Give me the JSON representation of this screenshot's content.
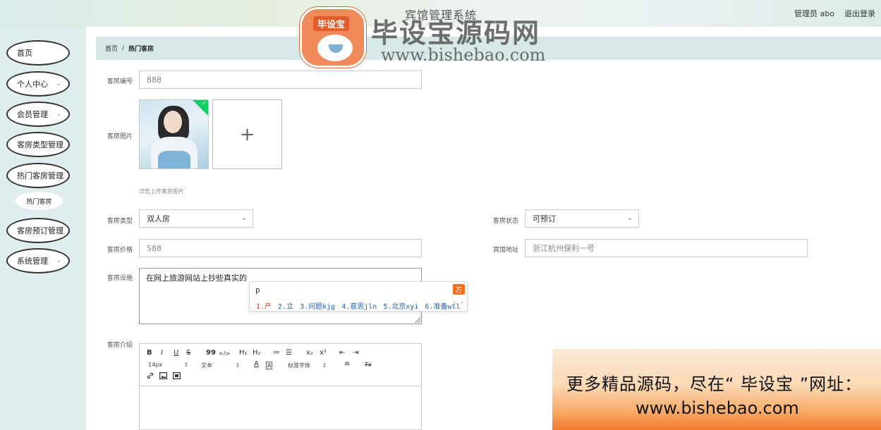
{
  "header": {
    "system_title": "宾馆管理系统",
    "user_label": "管理员 abo",
    "logout_label": "退出登录"
  },
  "sidebar": {
    "items": [
      {
        "label": "首页",
        "has_chevron": false
      },
      {
        "label": "个人中心",
        "has_chevron": true
      },
      {
        "label": "会员管理",
        "has_chevron": true
      },
      {
        "label": "客房类型管理",
        "has_chevron": false
      },
      {
        "label": "热门客房管理",
        "has_chevron": false
      },
      {
        "label": "客房预订管理",
        "has_chevron": false
      },
      {
        "label": "系统管理",
        "has_chevron": true
      }
    ],
    "sub_item": "热门客房"
  },
  "breadcrumb": {
    "home": "首页",
    "separator": "/",
    "current": "热门客房"
  },
  "form": {
    "room_no": {
      "label": "客房编号",
      "value": "888"
    },
    "room_image": {
      "label": "客房图片",
      "hint": "点击上传客房图片",
      "plus": "+"
    },
    "room_type": {
      "label": "客房类型",
      "value": "双人房"
    },
    "room_status": {
      "label": "客房状态",
      "value": "可预订"
    },
    "room_price": {
      "label": "客房价格",
      "value": "588"
    },
    "hotel_address": {
      "label": "宾馆地址",
      "value": "浙江杭州保利一号"
    },
    "facilities": {
      "label": "客房设施",
      "value": "在网上旅游网站上抄些真实的"
    },
    "intro": {
      "label": "客房介绍"
    }
  },
  "ime": {
    "composition": "p",
    "logo": "万",
    "candidates": [
      "1.产",
      "2.立",
      "3.问题kjg",
      "4.意思jln",
      "5.北京xyi",
      "6.准备wtl"
    ],
    "arrows": "‹ ›"
  },
  "editor": {
    "toolbar": {
      "bold": "B",
      "italic": "I",
      "underline": "U",
      "strike": "S",
      "quote": "99",
      "code": "</>",
      "h1": "H₁",
      "h2": "H₂",
      "ol": "≔",
      "ul": "☰",
      "sub": "x₂",
      "sup": "x²",
      "indent_dec": "⇤",
      "indent_inc": "⇥",
      "size": "14px",
      "text_style": "文本",
      "color": "A",
      "bg": "A",
      "font": "标准字体",
      "align": "≡",
      "clean": "Tx",
      "link": "link-icon",
      "image": "image-icon",
      "video": "video-icon"
    }
  },
  "watermark": {
    "badge": "毕设宝",
    "title": "毕设宝源码网",
    "url": "www.bishebao.com"
  },
  "ad": {
    "line1": "更多精品源码，尽在“ 毕设宝 ”网址：",
    "line2": "www.bishebao.com"
  }
}
